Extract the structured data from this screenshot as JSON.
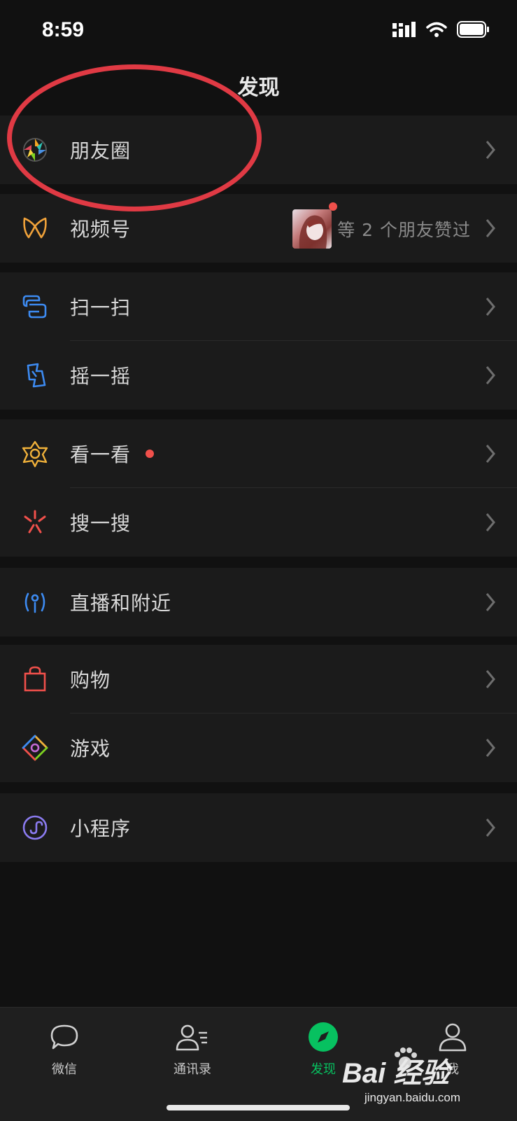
{
  "status_bar": {
    "time": "8:59"
  },
  "header": {
    "title": "发现"
  },
  "menu": {
    "moments": {
      "label": "朋友圈"
    },
    "channels": {
      "label": "视频号",
      "liked_text": "等 2 个朋友赞过"
    },
    "scan": {
      "label": "扫一扫"
    },
    "shake": {
      "label": "摇一摇"
    },
    "top_stories": {
      "label": "看一看"
    },
    "search": {
      "label": "搜一搜"
    },
    "live_nearby": {
      "label": "直播和附近"
    },
    "shopping": {
      "label": "购物"
    },
    "games": {
      "label": "游戏"
    },
    "mini_programs": {
      "label": "小程序"
    }
  },
  "tab_bar": {
    "chats": "微信",
    "contacts": "通讯录",
    "discover": "发现",
    "me": "我"
  },
  "watermark": {
    "brand": "Bai 经验",
    "url": "jingyan.baidu.com"
  },
  "colors": {
    "accent": "#07c160",
    "badge": "#f0504b",
    "annotation": "#e03a44"
  }
}
